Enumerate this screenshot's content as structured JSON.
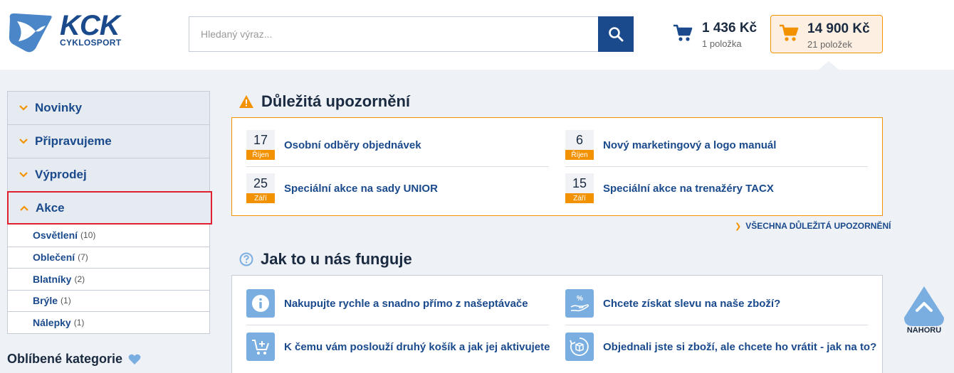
{
  "brand": {
    "name": "KCK",
    "sub": "CYKLOSPORT"
  },
  "search": {
    "placeholder": "Hledaný výraz..."
  },
  "carts": [
    {
      "price": "1 436 Kč",
      "count": "1 položka"
    },
    {
      "price": "14 900 Kč",
      "count": "21 položek"
    }
  ],
  "sidebar": {
    "categories": [
      {
        "label": "Novinky"
      },
      {
        "label": "Připravujeme"
      },
      {
        "label": "Výprodej"
      },
      {
        "label": "Akce"
      }
    ],
    "subitems": [
      {
        "label": "Osvětlení",
        "count": "(10)"
      },
      {
        "label": "Oblečení",
        "count": "(7)"
      },
      {
        "label": "Blatníky",
        "count": "(2)"
      },
      {
        "label": "Brýle",
        "count": "(1)"
      },
      {
        "label": "Nálepky",
        "count": "(1)"
      }
    ],
    "favorites": "Oblíbené kategorie"
  },
  "notices": {
    "title": "Důležitá upozornění",
    "items": [
      {
        "day": "17",
        "month": "Říjen",
        "text": "Osobní odběry objednávek"
      },
      {
        "day": "6",
        "month": "Říjen",
        "text": "Nový marketingový a logo manuál"
      },
      {
        "day": "25",
        "month": "Září",
        "text": "Speciální akce na sady UNIOR"
      },
      {
        "day": "15",
        "month": "Září",
        "text": "Speciální akce na trenažéry TACX"
      }
    ],
    "all_link": "VŠECHNA DŮLEŽITÁ UPOZORNĚNÍ"
  },
  "howto": {
    "title": "Jak to u nás funguje",
    "items": [
      {
        "icon": "info-icon",
        "text": "Nakupujte rychle a snadno přímo z našeptávače"
      },
      {
        "icon": "discount-hand-icon",
        "text": "Chcete získat slevu na naše zboží?"
      },
      {
        "icon": "cart-plus-icon",
        "text": "K čemu vám poslouží druhý košík a jak jej aktivujete"
      },
      {
        "icon": "return-box-icon",
        "text": "Objednali jste si zboží, ale chcete ho vrátit - jak na to?"
      }
    ]
  },
  "back_to_top": "NAHORU",
  "colors": {
    "primary": "#1a4a8c",
    "accent": "#f39200",
    "highlight": "#e0202f"
  }
}
